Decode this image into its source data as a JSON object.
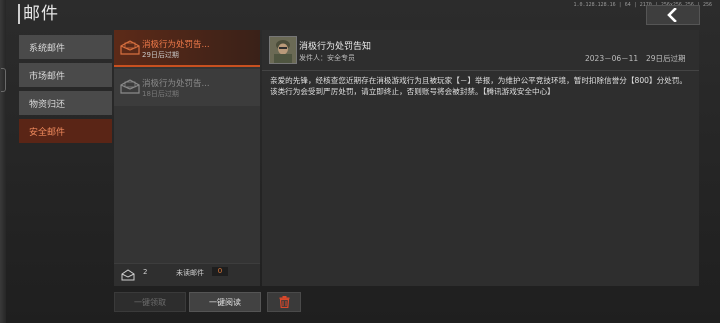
{
  "header": {
    "title": "邮件",
    "version_text": "1.0.128.128.16 | 64 | 2170  | 256x256.256 | 256",
    "back_icon": "chevron-left-icon"
  },
  "sidebar": {
    "items": [
      {
        "label": "系统邮件",
        "active": false
      },
      {
        "label": "市场邮件",
        "active": false
      },
      {
        "label": "物资归还",
        "active": false
      },
      {
        "label": "安全邮件",
        "active": true
      }
    ]
  },
  "mail_list": {
    "items": [
      {
        "title": "消极行为处罚告...",
        "expiry": "29日后过期",
        "icon": "envelope-open-icon",
        "selected": true
      },
      {
        "title": "消极行为处罚告...",
        "expiry": "18日后过期",
        "icon": "envelope-open-icon",
        "selected": false
      }
    ],
    "footer": {
      "icon": "mail-stack-icon",
      "total_count": "2",
      "unread_label": "未读邮件",
      "unread_count": "0"
    }
  },
  "actions": {
    "collect_all": "一键领取",
    "read_all": "一键阅读",
    "delete_icon": "trash-icon"
  },
  "detail": {
    "subject": "消极行为处罚告知",
    "sender": "发件人：安全专员",
    "date": "2023－06－11",
    "expiry": "29日后过期",
    "body": "亲爱的先锋，经核查您近期存在消极游戏行为且被玩家【－】举报，为维护公平竞技环境，暂时扣除信誉分【800】分处罚。该类行为会受到严厉处罚，请立即终止，否则账号将会被封禁。【腾讯游戏安全中心】"
  },
  "colors": {
    "accent": "#f07a4a",
    "active_bg": "#5a2516",
    "delete_red": "#d9482b"
  }
}
